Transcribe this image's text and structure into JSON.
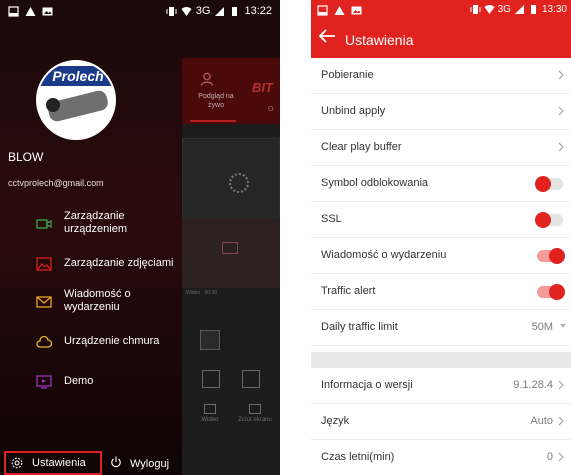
{
  "left_phone": {
    "status": {
      "time": "13:22",
      "network": "3G"
    },
    "background_app": {
      "brand": "BIT",
      "tab_live": "Podgląd na żywo",
      "tab_other": "O",
      "video_label": "Wideo · 00:00",
      "bottom_video": "Wideo",
      "bottom_screenshot": "Zrzut ekranu"
    },
    "drawer": {
      "avatar_logo": "Prolech",
      "username": "BLOW",
      "email": "cctvprolech@gmail.com",
      "menu": [
        {
          "label": "Zarządzanie urządzeniem",
          "icon": "camera-icon",
          "color": "#3aa34a"
        },
        {
          "label": "Zarządzanie zdjęciami",
          "icon": "picture-icon",
          "color": "#e02020"
        },
        {
          "label": "Wiadomość o wydarzeniu",
          "icon": "envelope-icon",
          "color": "#e6a325"
        },
        {
          "label": "Urządzenie chmura",
          "icon": "cloud-icon",
          "color": "#e6b825"
        },
        {
          "label": "Demo",
          "icon": "demo-icon",
          "color": "#9b2fc0"
        }
      ],
      "settings_label": "Ustawienia",
      "logout_label": "Wyloguj"
    }
  },
  "right_phone": {
    "status": {
      "time": "13:30",
      "network": "3G"
    },
    "header": {
      "title": "Ustawienia"
    },
    "accent": "#e0231f",
    "rows": [
      {
        "label": "Pobieranie",
        "kind": "chevron"
      },
      {
        "label": "Unbind apply",
        "kind": "chevron"
      },
      {
        "label": "Clear play buffer",
        "kind": "chevron"
      },
      {
        "label": "Symbol odblokowania",
        "kind": "toggle",
        "on": false
      },
      {
        "label": "SSL",
        "kind": "toggle",
        "on": false
      },
      {
        "label": "Wiadomość o wydarzeniu",
        "kind": "toggle",
        "on": true
      },
      {
        "label": "Traffic alert",
        "kind": "toggle",
        "on": true
      },
      {
        "label": "Daily traffic limit",
        "kind": "dropdown",
        "value": "50M"
      },
      {
        "label": "Informacja o wersji",
        "kind": "value-chevron",
        "value": "9.1.28.4"
      },
      {
        "label": "Język",
        "kind": "value-chevron",
        "value": "Auto"
      },
      {
        "label": "Czas letni(min)",
        "kind": "value-chevron",
        "value": "0"
      }
    ]
  }
}
